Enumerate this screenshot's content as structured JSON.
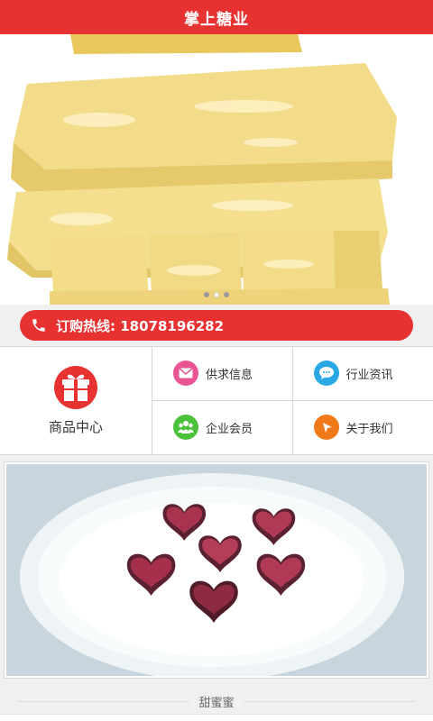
{
  "header": {
    "title": "掌上糖业"
  },
  "banner": {
    "slide_count": 3,
    "active_slide": 2
  },
  "hotline": {
    "text": "订购热线: 18078196282",
    "icon": "phone-icon"
  },
  "menu": {
    "main": {
      "label": "商品中心",
      "icon": "gift-icon"
    },
    "items": [
      {
        "label": "供求信息",
        "icon": "mail-icon",
        "color": "#e85592"
      },
      {
        "label": "行业资讯",
        "icon": "chat-icon",
        "color": "#2aa8e4"
      },
      {
        "label": "企业会员",
        "icon": "users-icon",
        "color": "#4cc23c"
      },
      {
        "label": "关于我们",
        "icon": "pointer-icon",
        "color": "#f07a1a"
      }
    ]
  },
  "section": {
    "title": "甜蜜蜜"
  },
  "colors": {
    "brand": "#e83232"
  }
}
